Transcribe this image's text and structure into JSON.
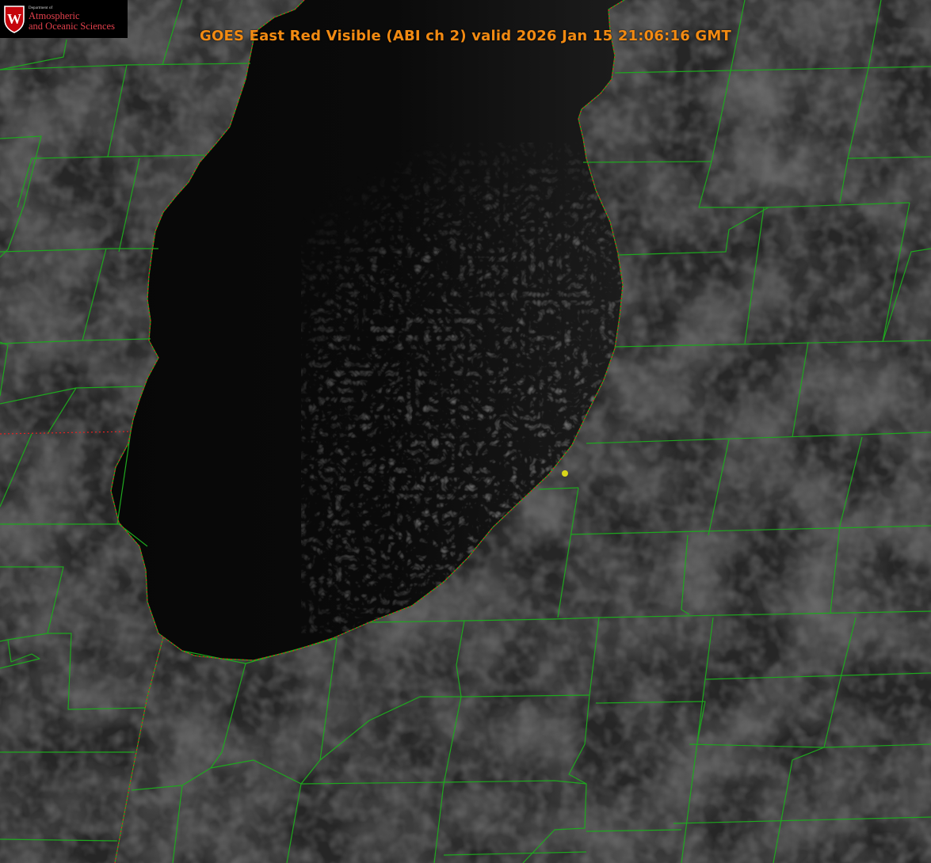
{
  "map": {
    "title": "GOES East Red Visible (ABI ch 2) valid 2026 Jan 15 21:06:16 GMT",
    "title_color": "#f28a12",
    "boundary_color": "#1ea81e",
    "shoreline_color": "#e02222",
    "marker_color": "#d9d61a",
    "lake_color": "#050505",
    "land_color": "#2a2a2a"
  },
  "logo": {
    "department": "Department of",
    "line1": "Atmospheric",
    "line2": "and Oceanic Sciences",
    "crest_letter": "W",
    "crest_color": "#c5050c"
  }
}
